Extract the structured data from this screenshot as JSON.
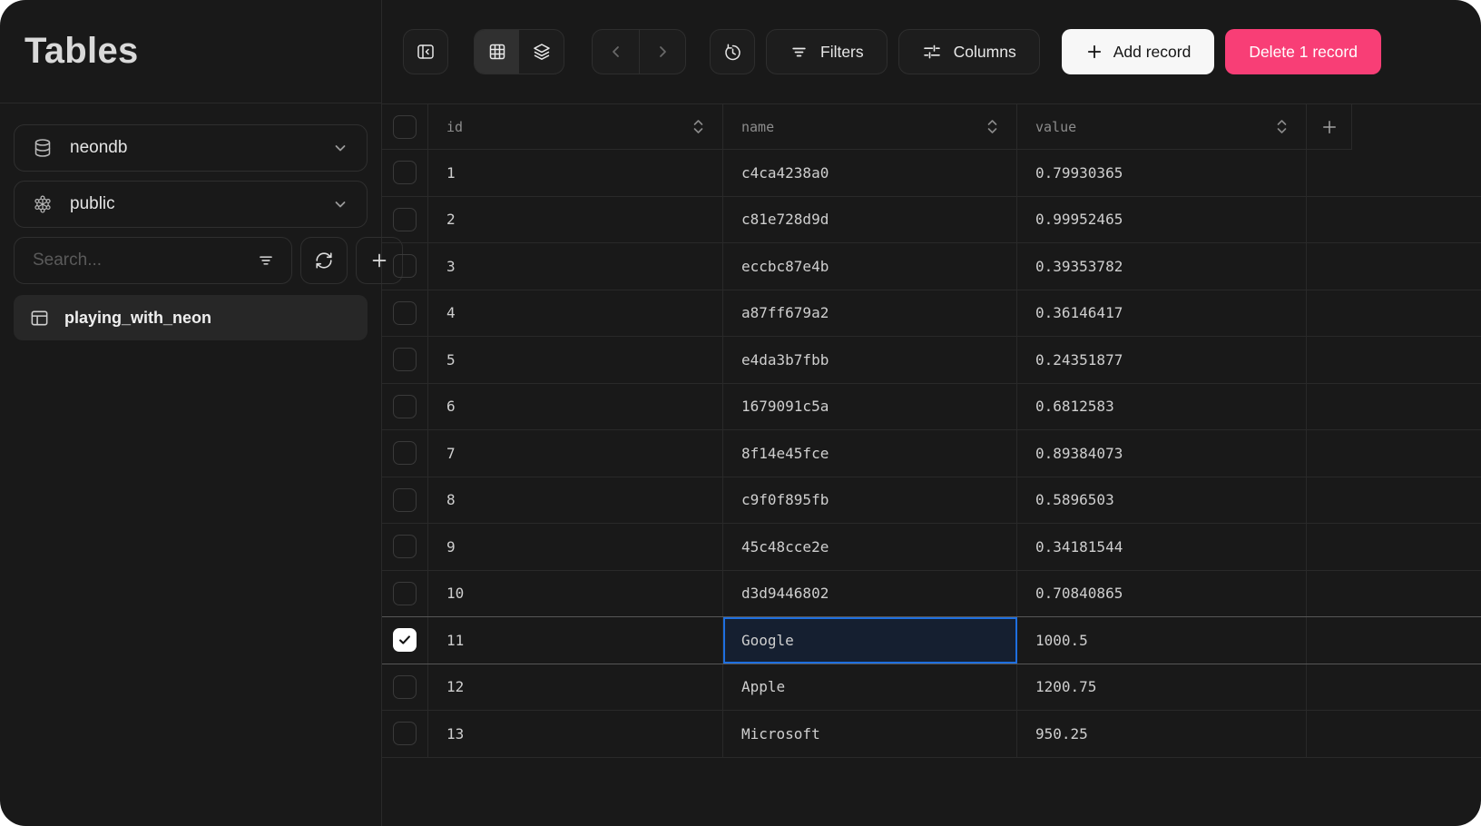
{
  "app": {
    "title": "Tables"
  },
  "colors": {
    "background": "#191919",
    "border": "#2a2a2a",
    "accent_pink": "#f83e76",
    "selection_blue": "#1e6fe0",
    "selected_cell_bg": "#151f30",
    "add_button_bg": "#f7f7f7"
  },
  "sidebar": {
    "title": "Tables",
    "database_selector": {
      "icon": "database-icon",
      "value": "neondb"
    },
    "schema_selector": {
      "icon": "schema-icon",
      "value": "public"
    },
    "search": {
      "placeholder": "Search...",
      "icon": "filter-lines-icon"
    },
    "refresh_button": {
      "icon": "refresh-icon"
    },
    "add_table_button": {
      "icon": "plus-icon"
    },
    "tables": [
      {
        "icon": "table-icon",
        "name": "playing_with_neon",
        "selected": true
      }
    ]
  },
  "toolbar": {
    "collapse_sidebar": {
      "icon": "panel-left-collapse-icon"
    },
    "view_switcher": {
      "options": [
        "grid-view-icon",
        "layers-view-icon"
      ],
      "active": "grid-view-icon"
    },
    "pagination": {
      "prev_icon": "chevron-left-icon",
      "next_icon": "chevron-right-icon",
      "enabled": false
    },
    "history": {
      "icon": "history-icon"
    },
    "filters": {
      "icon": "filter-lines-icon",
      "label": "Filters"
    },
    "columns": {
      "icon": "sliders-icon",
      "label": "Columns"
    },
    "add_record": {
      "icon": "plus-icon",
      "label": "Add record"
    },
    "delete_record": {
      "label": "Delete 1 record"
    }
  },
  "data_table": {
    "select_all_checked": false,
    "columns": [
      {
        "key": "id",
        "label": "id",
        "sortable": true
      },
      {
        "key": "name",
        "label": "name",
        "sortable": true
      },
      {
        "key": "value",
        "label": "value",
        "sortable": true
      }
    ],
    "add_column": {
      "icon": "plus-icon"
    },
    "selected_cell": {
      "row_id": "11",
      "column": "name"
    },
    "rows": [
      {
        "id": "1",
        "name": "c4ca4238a0",
        "value": "0.79930365",
        "checked": false
      },
      {
        "id": "2",
        "name": "c81e728d9d",
        "value": "0.99952465",
        "checked": false
      },
      {
        "id": "3",
        "name": "eccbc87e4b",
        "value": "0.39353782",
        "checked": false
      },
      {
        "id": "4",
        "name": "a87ff679a2",
        "value": "0.36146417",
        "checked": false
      },
      {
        "id": "5",
        "name": "e4da3b7fbb",
        "value": "0.24351877",
        "checked": false
      },
      {
        "id": "6",
        "name": "1679091c5a",
        "value": "0.6812583",
        "checked": false
      },
      {
        "id": "7",
        "name": "8f14e45fce",
        "value": "0.89384073",
        "checked": false
      },
      {
        "id": "8",
        "name": "c9f0f895fb",
        "value": "0.5896503",
        "checked": false
      },
      {
        "id": "9",
        "name": "45c48cce2e",
        "value": "0.34181544",
        "checked": false
      },
      {
        "id": "10",
        "name": "d3d9446802",
        "value": "0.70840865",
        "checked": false
      },
      {
        "id": "11",
        "name": "Google",
        "value": "1000.5",
        "checked": true
      },
      {
        "id": "12",
        "name": "Apple",
        "value": "1200.75",
        "checked": false
      },
      {
        "id": "13",
        "name": "Microsoft",
        "value": "950.25",
        "checked": false
      }
    ]
  }
}
